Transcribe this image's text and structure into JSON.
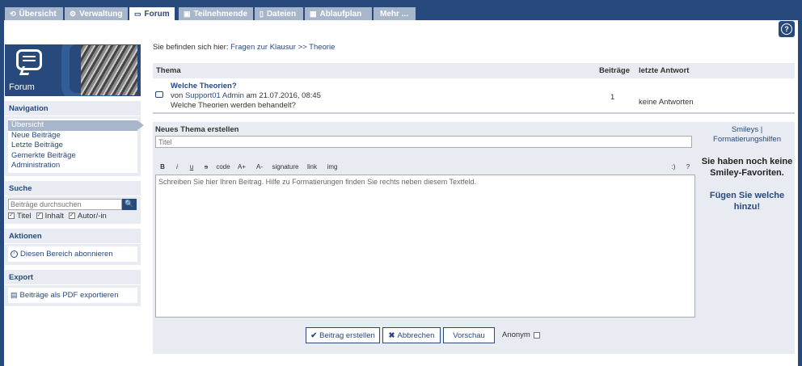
{
  "tabs": [
    {
      "icon": "⟲",
      "label": "Übersicht",
      "active": false
    },
    {
      "icon": "⚙",
      "label": "Verwaltung",
      "active": false
    },
    {
      "icon": "▭",
      "label": "Forum",
      "active": true
    },
    {
      "icon": "▣",
      "label": "Teilnehmende",
      "active": false
    },
    {
      "icon": "▯",
      "label": "Dateien",
      "active": false
    },
    {
      "icon": "▦",
      "label": "Ablaufplan",
      "active": false
    },
    {
      "icon": "",
      "label": "Mehr ...",
      "active": false
    }
  ],
  "sidebar": {
    "title": "Forum",
    "navigation": {
      "heading": "Navigation",
      "items": [
        "Übersicht",
        "Neue Beiträge",
        "Letzte Beiträge",
        "Gemerkte Beiträge",
        "Administration"
      ]
    },
    "search": {
      "heading": "Suche",
      "placeholder": "Beiträge durchsuchen",
      "options": [
        "Titel",
        "Inhalt",
        "Autor/-in"
      ]
    },
    "actions": {
      "heading": "Aktionen",
      "item": "Diesen Bereich abonnieren"
    },
    "export": {
      "heading": "Export",
      "item": "Beiträge als PDF exportieren"
    }
  },
  "breadcrumb": {
    "prefix": "Sie befinden sich hier:",
    "part1": "Fragen zur Klausur",
    "sep": ">>",
    "part2": "Theorie"
  },
  "table": {
    "headers": {
      "thema": "Thema",
      "beitraege": "Beiträge",
      "letzte": "letzte Antwort"
    },
    "row": {
      "title": "Welche Theorien?",
      "by": "von",
      "author": "Support01 Admin",
      "date": "am 21.07.2016, 08:45",
      "desc": "Welche Theorien werden behandelt?",
      "count": "1",
      "last": "keine Antworten"
    }
  },
  "newtopic": {
    "heading": "Neues Thema erstellen",
    "title_placeholder": "Titel",
    "toolbar": [
      "B",
      "i",
      "u",
      "s",
      "code",
      "A+",
      "A-",
      "signature",
      "link",
      "img"
    ],
    "toolbar_right": [
      ":)",
      "?"
    ],
    "editor_placeholder": "Schreiben Sie hier Ihren Beitrag. Hilfe zu Formatierungen finden Sie rechts neben diesem Textfeld.",
    "smiley_link1": "Smileys |",
    "smiley_link2": "Formatierungshilfen",
    "smiley_msg": "Sie haben noch keine Smiley-Favoriten.",
    "smiley_add": "Fügen Sie welche hinzu!"
  },
  "buttons": {
    "create": "Beitrag erstellen",
    "cancel": "Abbrechen",
    "preview": "Vorschau",
    "anon": "Anonym"
  },
  "colors": {
    "primary": "#28497c",
    "tab_inactive": "#a8b6cc",
    "panel": "#e8ecf2"
  }
}
